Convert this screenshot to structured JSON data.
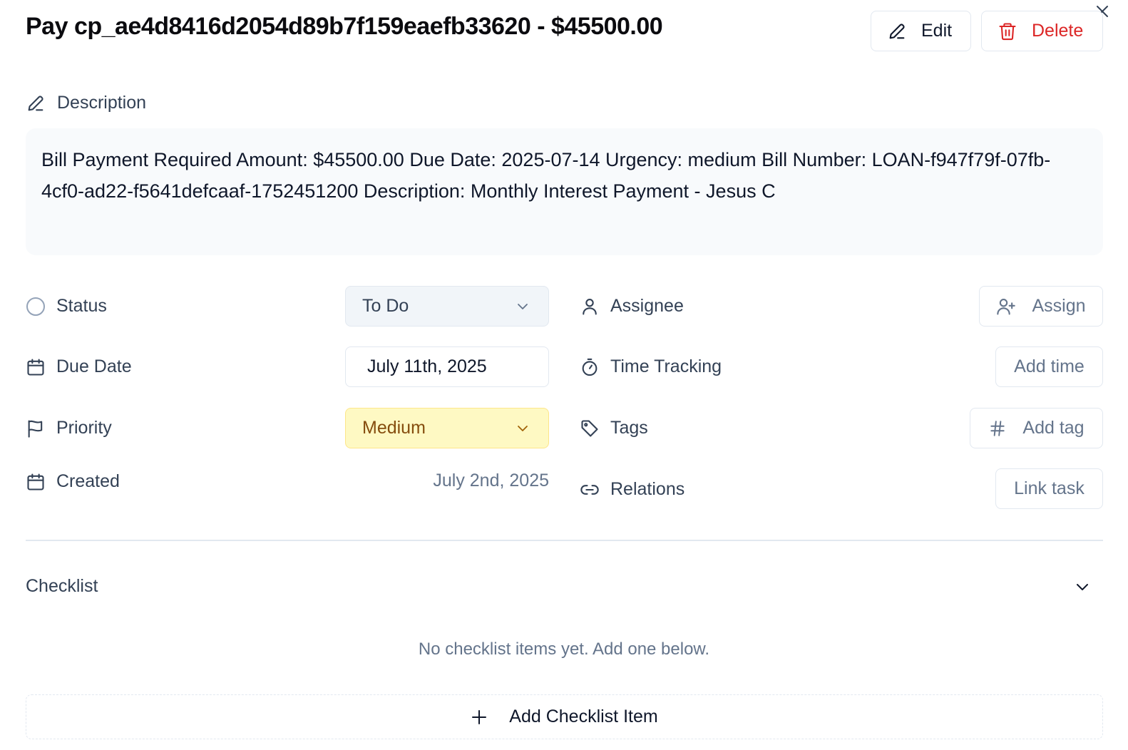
{
  "header": {
    "title": "Pay cp_ae4d8416d2054d89b7f159eaefb33620 - $45500.00",
    "edit_label": "Edit",
    "delete_label": "Delete",
    "close_icon": "close-icon"
  },
  "description": {
    "label": "Description",
    "text": "Bill Payment Required Amount: $45500.00 Due Date: 2025-07-14 Urgency: medium Bill Number: LOAN-f947f79f-07fb-4cf0-ad22-f5641defcaaf-1752451200 Description: Monthly Interest Payment - Jesus C"
  },
  "properties": {
    "status": {
      "label": "Status",
      "value": "To Do",
      "icon": "circle-icon"
    },
    "due_date": {
      "label": "Due Date",
      "value": "July 11th, 2025",
      "icon": "calendar-icon"
    },
    "priority": {
      "label": "Priority",
      "value": "Medium",
      "icon": "flag-icon",
      "color": "#fef9c3"
    },
    "created": {
      "label": "Created",
      "value": "July 2nd, 2025",
      "icon": "calendar-icon"
    },
    "assignee": {
      "label": "Assignee",
      "button": "Assign",
      "icon": "user-icon"
    },
    "time_tracking": {
      "label": "Time Tracking",
      "button": "Add time",
      "icon": "timer-icon"
    },
    "tags": {
      "label": "Tags",
      "button": "Add tag",
      "icon": "tag-icon"
    },
    "relations": {
      "label": "Relations",
      "button": "Link task",
      "icon": "link-icon"
    }
  },
  "checklist": {
    "title": "Checklist",
    "empty_message": "No checklist items yet. Add one below.",
    "add_label": "Add Checklist Item"
  },
  "colors": {
    "danger": "#dc2626",
    "muted_text": "#64748b",
    "priority_bg": "#fef9c3",
    "priority_text": "#854d0e"
  }
}
